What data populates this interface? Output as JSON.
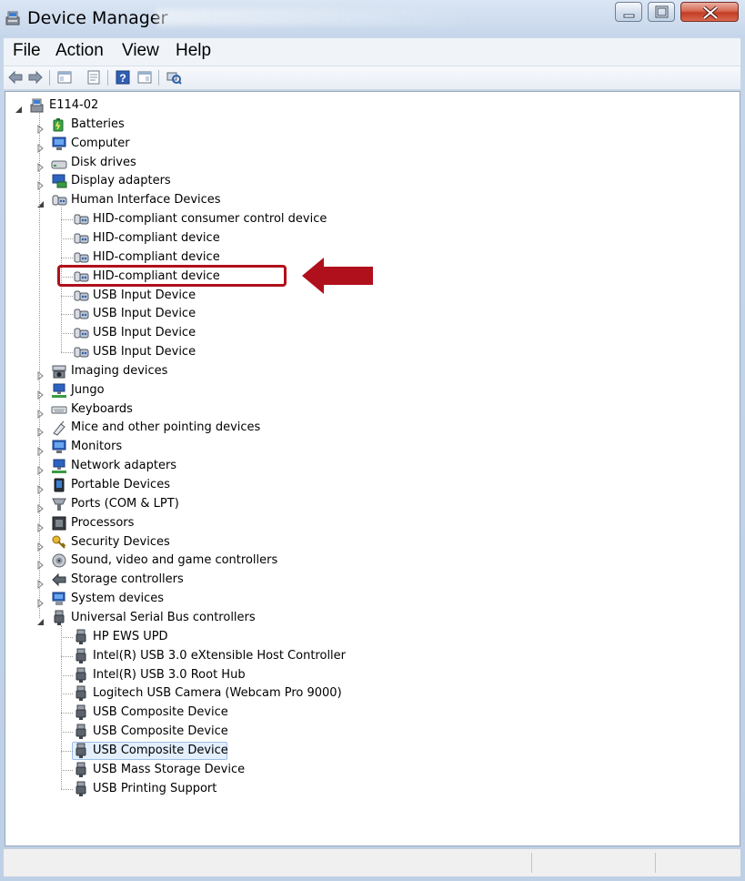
{
  "window": {
    "title": "Device Manager"
  },
  "menu": [
    "File",
    "Action",
    "View",
    "Help"
  ],
  "toolbar": [
    "back-arrow-icon",
    "forward-arrow-icon",
    "show-hide-console-tree-icon",
    "properties-icon",
    "help-icon",
    "action-pane-icon",
    "scan-hardware-icon"
  ],
  "tree": {
    "root": {
      "label": "E114-02",
      "icon": "computer-icon",
      "expanded": true
    },
    "categories": [
      {
        "label": "Batteries",
        "icon": "battery-icon",
        "expanded": false
      },
      {
        "label": "Computer",
        "icon": "monitor-icon",
        "expanded": false
      },
      {
        "label": "Disk drives",
        "icon": "disk-drive-icon",
        "expanded": false
      },
      {
        "label": "Display adapters",
        "icon": "display-adapter-icon",
        "expanded": false
      },
      {
        "label": "Human Interface Devices",
        "icon": "hid-icon",
        "expanded": true,
        "children": [
          "HID-compliant consumer control device",
          "HID-compliant device",
          "HID-compliant device",
          "HID-compliant device",
          "USB Input Device",
          "USB Input Device",
          "USB Input Device",
          "USB Input Device"
        ]
      },
      {
        "label": "Imaging devices",
        "icon": "camera-icon",
        "expanded": false
      },
      {
        "label": "Jungo",
        "icon": "network-icon",
        "expanded": false
      },
      {
        "label": "Keyboards",
        "icon": "keyboard-icon",
        "expanded": false
      },
      {
        "label": "Mice and other pointing devices",
        "icon": "mouse-icon",
        "expanded": false
      },
      {
        "label": "Monitors",
        "icon": "monitor-icon",
        "expanded": false
      },
      {
        "label": "Network adapters",
        "icon": "network-icon",
        "expanded": false
      },
      {
        "label": "Portable Devices",
        "icon": "portable-device-icon",
        "expanded": false
      },
      {
        "label": "Ports (COM & LPT)",
        "icon": "port-icon",
        "expanded": false
      },
      {
        "label": "Processors",
        "icon": "processor-icon",
        "expanded": false
      },
      {
        "label": "Security Devices",
        "icon": "security-key-icon",
        "expanded": false
      },
      {
        "label": "Sound, video and game controllers",
        "icon": "speaker-icon",
        "expanded": false
      },
      {
        "label": "Storage controllers",
        "icon": "storage-controller-icon",
        "expanded": false
      },
      {
        "label": "System devices",
        "icon": "system-device-icon",
        "expanded": false
      },
      {
        "label": "Universal Serial Bus controllers",
        "icon": "usb-icon",
        "expanded": true,
        "children": [
          "HP EWS UPD",
          "Intel(R) USB 3.0 eXtensible Host Controller",
          "Intel(R) USB 3.0 Root Hub",
          "Logitech USB Camera (Webcam Pro 9000)",
          "USB Composite Device",
          "USB Composite Device",
          "USB Composite Device",
          "USB Mass Storage Device",
          "USB Printing Support"
        ]
      }
    ],
    "selected_item": "USB Composite Device",
    "highlighted_item": "HID-compliant device"
  },
  "colors": {
    "annotation": "#b0101b",
    "selection": "#e3effc"
  }
}
